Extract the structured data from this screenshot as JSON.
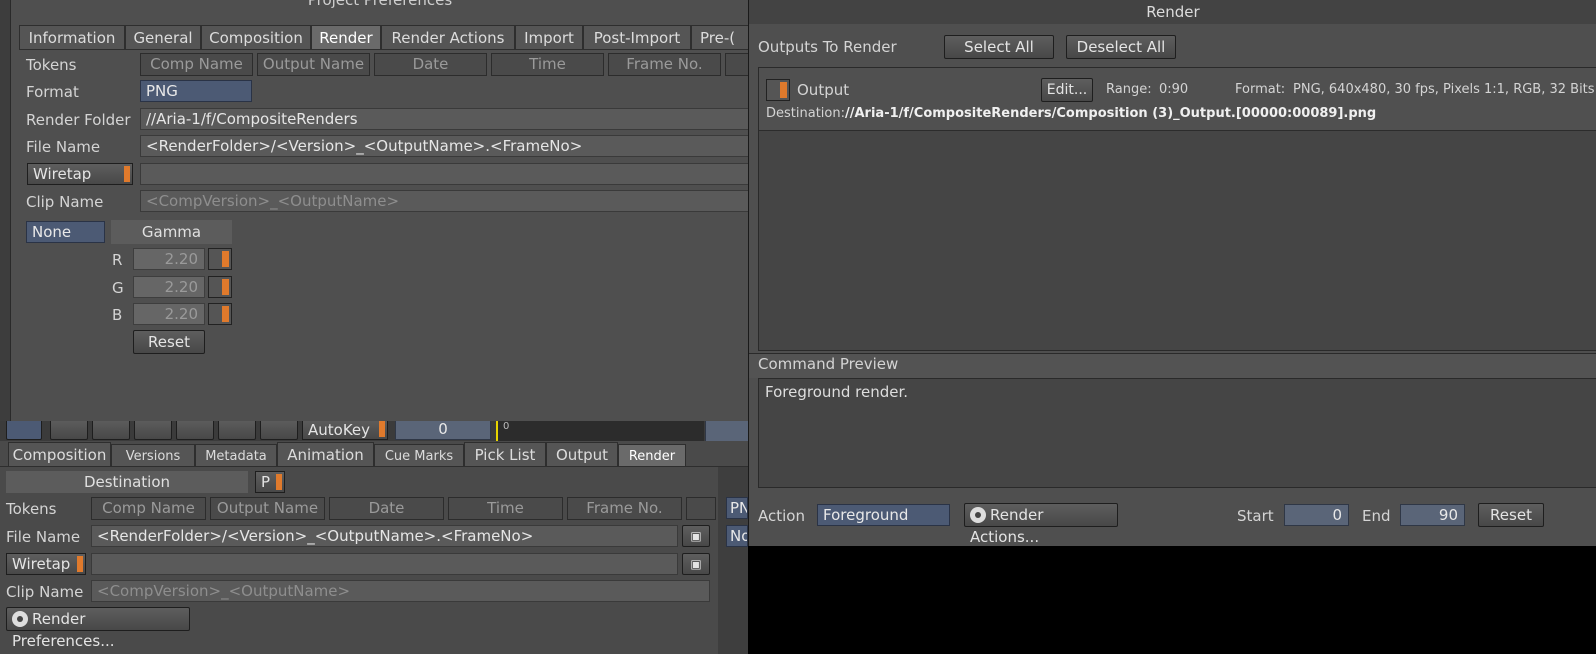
{
  "prefs": {
    "title": "Project Preferences",
    "tabs": [
      "Information",
      "General",
      "Composition",
      "Render",
      "Render Actions",
      "Import",
      "Post-Import",
      "Pre-("
    ],
    "tokens_label": "Tokens",
    "tokens": [
      "Comp Name",
      "Output Name",
      "Date",
      "Time",
      "Frame No."
    ],
    "format_label": "Format",
    "format_value": "PNG",
    "render_folder_label": "Render Folder",
    "render_folder_value": "//Aria-1/f/CompositeRenders",
    "file_name_label": "File Name",
    "file_name_value": "<RenderFolder>/<Version>_<OutputName>.<FrameNo>",
    "wiretap_label": "Wiretap",
    "clip_name_label": "Clip Name",
    "clip_name_value": "<CompVersion>_<OutputName>",
    "lut_value": "None",
    "gamma_label": "Gamma",
    "r_label": "R",
    "r_value": "2.20",
    "g_label": "G",
    "g_value": "2.20",
    "b_label": "B",
    "b_value": "2.20",
    "reset_label": "Reset"
  },
  "toolbar": {
    "autokey_label": "AutoKey",
    "frame_value": "0",
    "ruler_start": "0"
  },
  "bottom": {
    "tabs": [
      "Composition",
      "Versions",
      "Metadata",
      "Animation",
      "Cue Marks",
      "Pick List",
      "Output",
      "Render"
    ],
    "destination_label": "Destination",
    "p_label": "P",
    "tokens_label": "Tokens",
    "tokens": [
      "Comp Name",
      "Output Name",
      "Date",
      "Time",
      "Frame No."
    ],
    "file_name_label": "File Name",
    "file_name_value": "<RenderFolder>/<Version>_<OutputName>.<FrameNo>",
    "wiretap_label": "Wiretap",
    "clip_name_label": "Clip Name",
    "clip_name_value": "<CompVersion>_<OutputName>",
    "render_prefs_label": "Render Preferences...",
    "side_png": "PN",
    "side_none": "No"
  },
  "render": {
    "title": "Render",
    "outputs_label": "Outputs To Render",
    "select_all": "Select All",
    "deselect_all": "Deselect All",
    "output_name": "Output",
    "edit_label": "Edit...",
    "range_label": "Range:",
    "range_value": "0:90",
    "format_label": "Format:",
    "format_value": "PNG, 640x480, 30 fps, Pixels 1:1, RGB, 32 Bits",
    "destination_label": "Destination:",
    "destination_value": "//Aria-1/f/CompositeRenders/Composition (3)_Output.[00000:00089].png",
    "command_preview_label": "Command Preview",
    "command_preview_text": "Foreground render.",
    "action_label": "Action",
    "action_value": "Foreground",
    "render_actions_label": "Render Actions...",
    "start_label": "Start",
    "start_value": "0",
    "end_label": "End",
    "end_value": "90",
    "reset_label": "Reset"
  },
  "colors": {
    "accent_orange": "#e07a2c",
    "field_blue": "#4c5a74",
    "panel_bg": "#4f4f4f"
  }
}
